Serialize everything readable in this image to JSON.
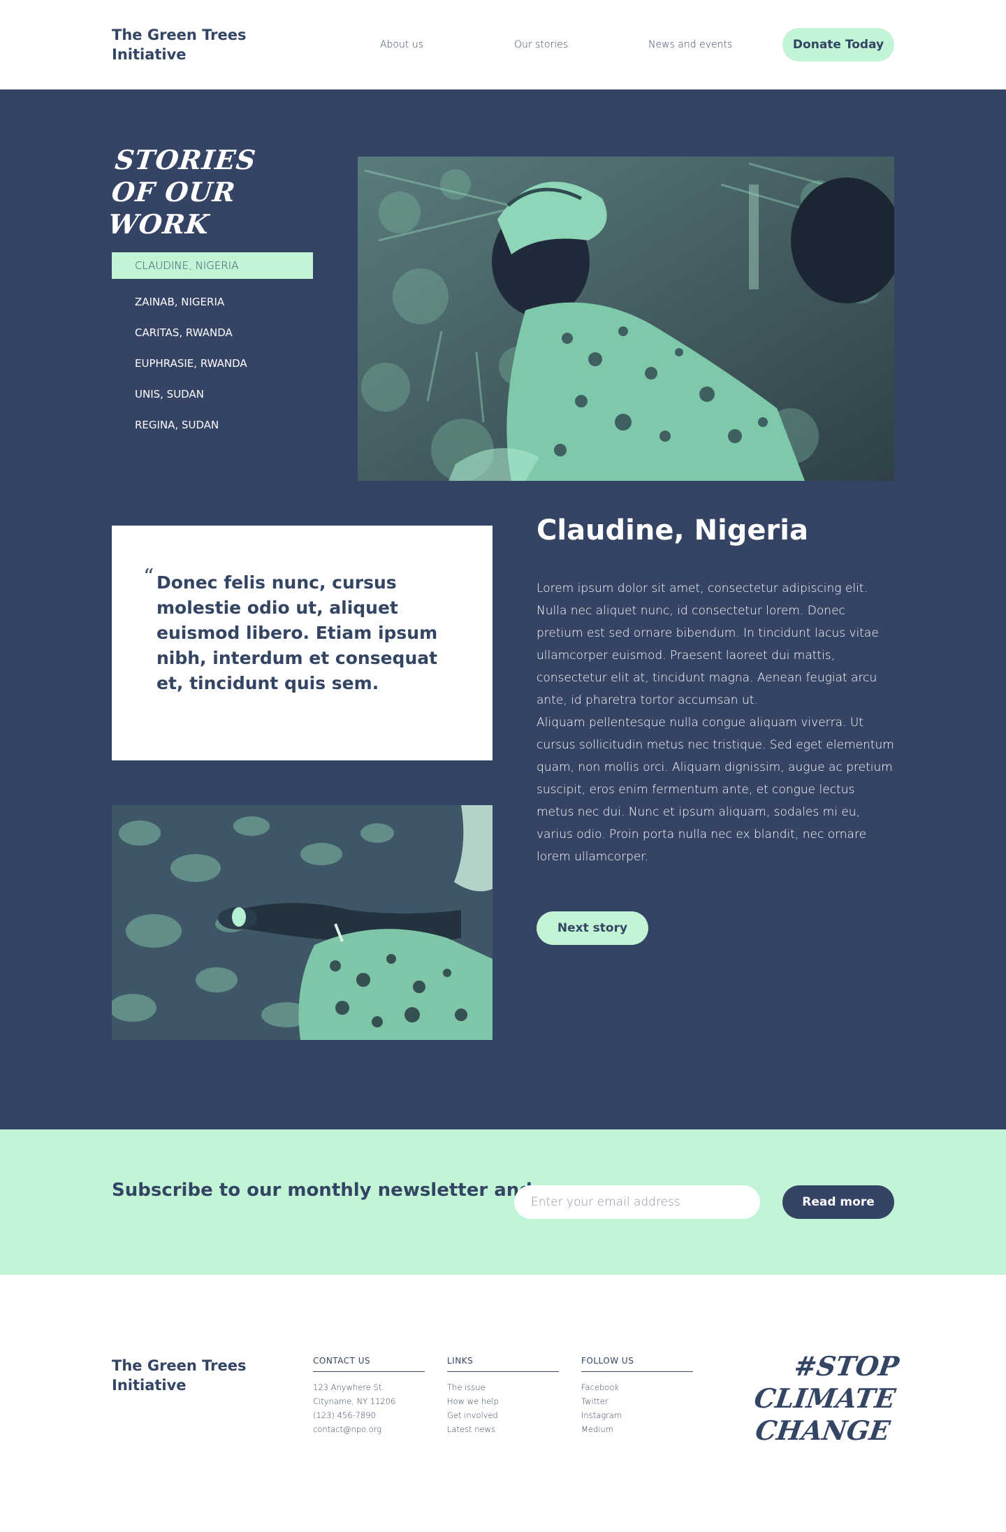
{
  "header": {
    "brand": "The Green Trees Initiative",
    "nav": [
      {
        "label": "About us"
      },
      {
        "label": "Our stories"
      },
      {
        "label": "News and events"
      }
    ],
    "donate_label": "Donate Today"
  },
  "hero": {
    "title": "Stories of our work",
    "stories": [
      {
        "label": "CLAUDINE, NIGERIA",
        "active": true
      },
      {
        "label": "ZAINAB, NIGERIA"
      },
      {
        "label": "CARITAS, RWANDA"
      },
      {
        "label": "EUPHRASIE, RWANDA"
      },
      {
        "label": "UNIS, SUDAN"
      },
      {
        "label": "REGINA, SUDAN"
      }
    ],
    "quote_mark": "“",
    "quote": "Donec felis nunc, cursus molestie odio ut, aliquet euismod libero. Etiam ipsum nibh, interdum et consequat et, tincidunt quis sem.",
    "story_name": "Claudine, Nigeria",
    "paragraphs": [
      "Lorem ipsum dolor sit amet, consectetur adipiscing elit. Nulla nec aliquet nunc, id consectetur lorem. Donec pretium est sed ornare bibendum. In tincidunt lacus vitae ullamcorper euismod. Praesent laoreet dui mattis, consectetur elit at, tincidunt magna. Aenean feugiat arcu ante, id pharetra tortor accumsan ut.",
      "Aliquam pellentesque nulla congue aliquam viverra. Ut cursus sollicitudin metus nec tristique. Sed eget elementum quam, non mollis orci. Aliquam dignissim, augue ac pretium suscipit, eros enim fermentum ante, et congue lectus metus nec dui. Nunc et ipsum aliquam, sodales mi eu, varius odio. Proin porta nulla nec ex blandit, nec ornare lorem ullamcorper."
    ],
    "next_label": "Next story"
  },
  "newsletter": {
    "text": "Subscribe to our monthly newsletter and",
    "placeholder": "Enter your email address",
    "button_label": "Read more"
  },
  "footer": {
    "brand": "The Green Trees Initiative",
    "contact": {
      "heading": "CONTACT US",
      "lines": [
        "123 Anywhere St.",
        "Cityname, NY 11206",
        "(123) 456-7890",
        "contact@npo.org"
      ]
    },
    "links": {
      "heading": "LINKS",
      "items": [
        "The issue",
        "How we help",
        "Get involved",
        "Latest news"
      ]
    },
    "follow": {
      "heading": "FOLLOW US",
      "items": [
        "Facebook",
        "Twitter",
        "Instagram",
        "Medium"
      ]
    },
    "hashtag": "#Stop climate change"
  },
  "colors": {
    "navy": "#354464",
    "mint": "#c2f5d6",
    "text": "#344563",
    "white": "#ffffff"
  }
}
